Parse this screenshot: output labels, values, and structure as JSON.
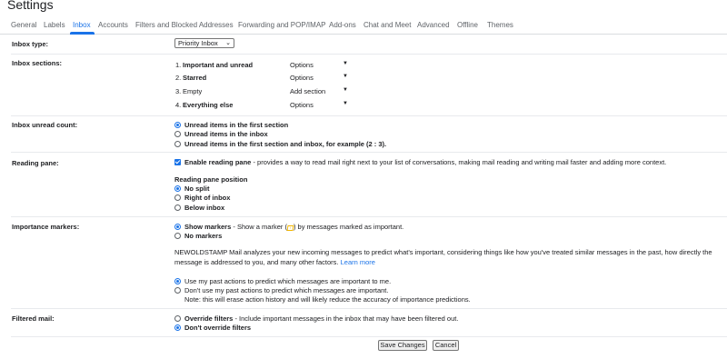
{
  "page": {
    "title": "Settings"
  },
  "tabs": [
    {
      "label": "General"
    },
    {
      "label": "Labels"
    },
    {
      "label": "Inbox"
    },
    {
      "label": "Accounts"
    },
    {
      "label": "Filters and Blocked Addresses"
    },
    {
      "label": "Forwarding and POP/IMAP"
    },
    {
      "label": "Add-ons"
    },
    {
      "label": "Chat and Meet"
    },
    {
      "label": "Advanced"
    },
    {
      "label": "Offline"
    },
    {
      "label": "Themes"
    }
  ],
  "active_tab": "Inbox",
  "accent_color": "#1a73e8",
  "inbox_type": {
    "label": "Inbox type:",
    "value": "Priority Inbox"
  },
  "inbox_sections": {
    "label": "Inbox sections:",
    "items": [
      {
        "num": "1.",
        "name": "Important and unread",
        "action": "Options"
      },
      {
        "num": "2.",
        "name": "Starred",
        "action": "Options"
      },
      {
        "num": "3.",
        "name": "Empty",
        "action": "Add section"
      },
      {
        "num": "4.",
        "name": "Everything else",
        "action": "Options"
      }
    ]
  },
  "unread_count": {
    "label": "Inbox unread count:",
    "options": [
      {
        "text": "Unread items in the first section",
        "selected": true
      },
      {
        "text": "Unread items in the inbox",
        "selected": false
      },
      {
        "text": "Unread items in the first section and inbox, for example (2 : 3).",
        "selected": false
      }
    ]
  },
  "reading_pane": {
    "label": "Reading pane:",
    "enable_bold": "Enable reading pane",
    "enable_rest": " - provides a way to read mail right next to your list of conversations, making mail reading and writing mail faster and adding more context.",
    "enabled": true,
    "position_label": "Reading pane position",
    "positions": [
      {
        "text": "No split",
        "selected": true
      },
      {
        "text": "Right of inbox",
        "selected": false
      },
      {
        "text": "Below inbox",
        "selected": false
      }
    ]
  },
  "importance": {
    "label": "Importance markers:",
    "show_bold": "Show markers",
    "show_rest_a": " - Show a marker (",
    "show_rest_b": ") by messages marked as important.",
    "show_selected": true,
    "no_markers": "No markers",
    "info_line1": "NEWOLDSTAMP Mail analyzes your new incoming messages to predict what's important, considering things like how you've treated similar messages in the past, how directly the",
    "info_line2": "message is addressed to you, and many other factors.",
    "learn_more": "Learn more",
    "use_past": "Use my past actions to predict which messages are important to me.",
    "use_past_selected": true,
    "dont_use": "Don't use my past actions to predict which messages are important.",
    "dont_use_note": "Note: this will erase action history and will likely reduce the accuracy of importance predictions."
  },
  "filtered": {
    "label": "Filtered mail:",
    "override_bold": "Override filters",
    "override_rest": " - Include important messages in the inbox that may have been filtered out.",
    "dont_override": "Don't override filters",
    "dont_override_selected": true
  },
  "buttons": {
    "save": "Save Changes",
    "cancel": "Cancel"
  }
}
